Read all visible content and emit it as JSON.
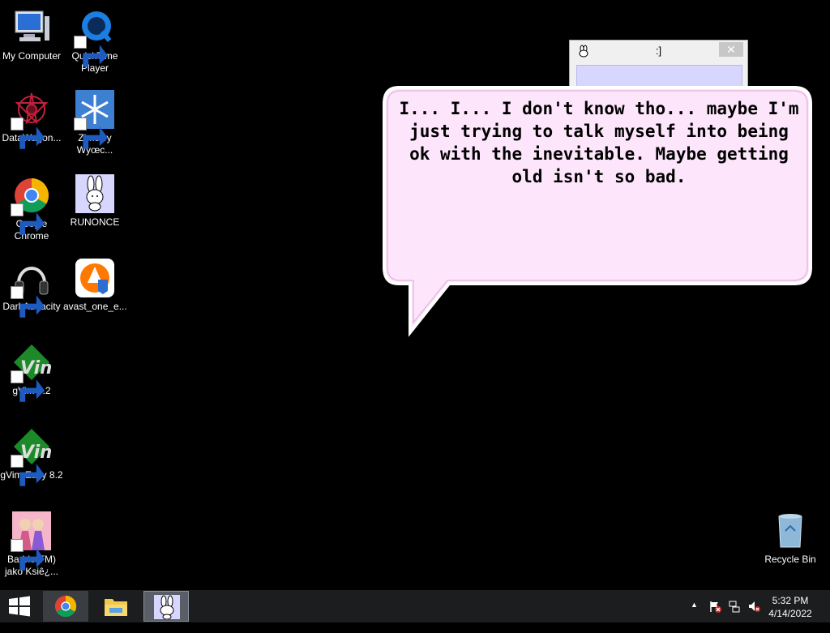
{
  "desktop": {
    "icons": [
      {
        "label": "My Computer",
        "icon": "computer-icon"
      },
      {
        "label": "QuickTime Player",
        "icon": "quicktime-icon"
      },
      {
        "label": "DataWagon...",
        "icon": "datawagon-icon"
      },
      {
        "label": "Zimowy Wyœc...",
        "icon": "snowflake-icon"
      },
      {
        "label": "Google Chrome",
        "icon": "chrome-icon"
      },
      {
        "label": "RUNONCE",
        "icon": "bunny-icon"
      },
      {
        "label": "DarkAudacity",
        "icon": "headphones-icon"
      },
      {
        "label": "avast_one_e...",
        "icon": "avast-icon"
      },
      {
        "label": "gVim 8.2",
        "icon": "gvim-icon"
      },
      {
        "label": "gVim Easy 8.2",
        "icon": "gvim-icon"
      },
      {
        "label": "Barbie(TM) jako Ksiê¿...",
        "icon": "barbie-icon"
      },
      {
        "label": "Recycle Bin",
        "icon": "recycle-bin-icon"
      }
    ]
  },
  "window": {
    "title": ":]",
    "close_label": "✕"
  },
  "bubble": {
    "text": "I... I... I don't know tho... maybe I'm just trying to talk myself into being ok with the inevitable. Maybe getting old isn't so bad."
  },
  "taskbar": {
    "start": "windows-logo-icon",
    "buttons": [
      {
        "name": "chrome-taskbar-button",
        "icon": "chrome-icon"
      },
      {
        "name": "file-explorer-taskbar-button",
        "icon": "folder-icon"
      },
      {
        "name": "bunny-app-taskbar-button",
        "icon": "bunny-icon"
      }
    ],
    "tray": {
      "expand": "▲",
      "time": "5:32 PM",
      "date": "4/14/2022"
    }
  },
  "colors": {
    "bubble_fill": "#fde6fb",
    "bubble_border": "#ffffff",
    "window_bar": "#d6d6ff",
    "taskbar": "#1b1d1f"
  }
}
